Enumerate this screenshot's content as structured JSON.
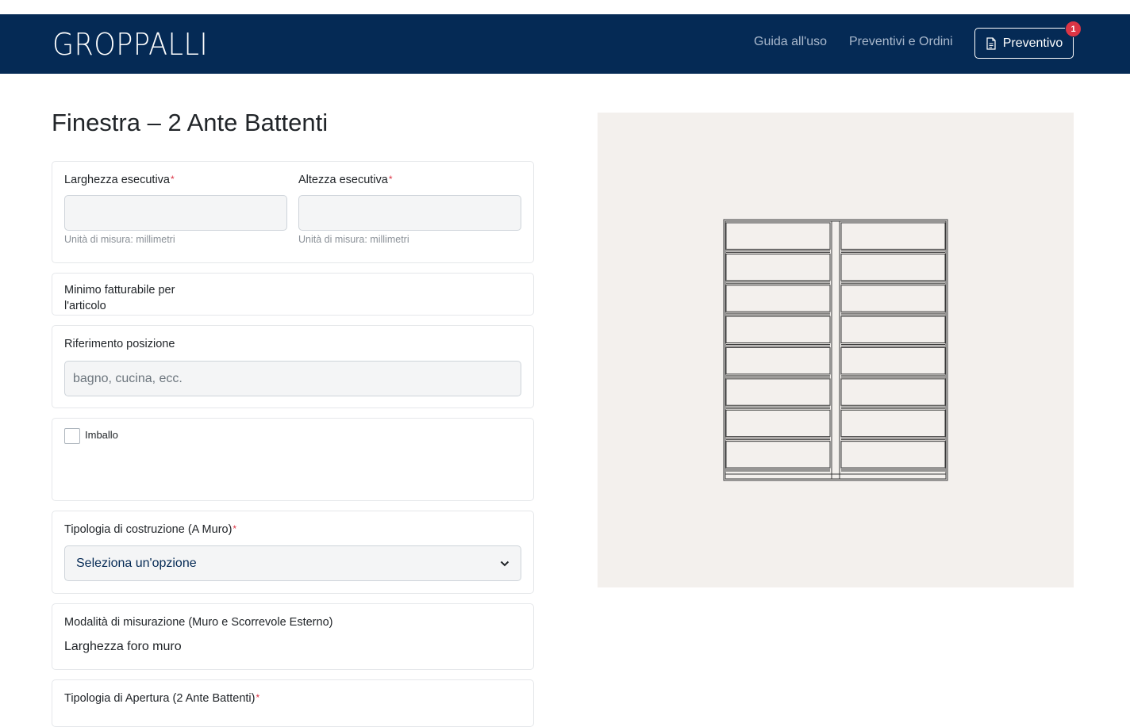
{
  "header": {
    "brand": "GROPPALLI",
    "nav": [
      {
        "label": "Guida all'uso"
      },
      {
        "label": "Preventivi e Ordini"
      }
    ],
    "quote_button": {
      "label": "Preventivo",
      "badge": "1"
    }
  },
  "page": {
    "title": "Finestra – 2 Ante Battenti"
  },
  "form": {
    "larghezza": {
      "label": "Larghezza esecutiva",
      "required": "*",
      "value": "",
      "help": "Unità di misura: millimetri"
    },
    "altezza": {
      "label": "Altezza esecutiva",
      "required": "*",
      "value": "",
      "help": "Unità di misura: millimetri"
    },
    "minimo": {
      "label": "Minimo fatturabile per l'articolo"
    },
    "riferimento": {
      "label": "Riferimento posizione",
      "placeholder": "bagno, cucina, ecc.",
      "value": ""
    },
    "imballo": {
      "label": "Imballo",
      "checked": false
    },
    "tipologia_costruzione": {
      "label": "Tipologia di costruzione (A Muro)",
      "required": "*",
      "selected": "Seleziona un'opzione"
    },
    "modalita": {
      "label": "Modalità di misurazione (Muro e Scorrevole Esterno)",
      "value": "Larghezza foro muro"
    },
    "tipologia_apertura": {
      "label": "Tipologia di Apertura (2 Ante Battenti)",
      "required": "*"
    }
  },
  "preview": {
    "image": "window-two-sash-drawing",
    "panes_per_sash": 8,
    "background": "#f3f0ed"
  },
  "colors": {
    "navbar": "#052a55",
    "required": "#dc3545",
    "select_text": "#052a55"
  }
}
